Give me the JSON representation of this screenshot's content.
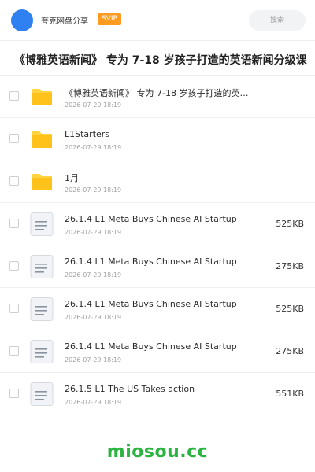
{
  "header": {
    "site_name": "夸克网盘分享",
    "badge": "SVIP",
    "search_placeholder": "搜索"
  },
  "title": "《博雅英语新闻》 专为 7-18 岁孩子打造的英语新闻分级课",
  "colors": {
    "accent": "#2f80f0",
    "badge": "#ff9b21",
    "folder": "#ffc52e",
    "brand_green": "#2bb441"
  },
  "files": [
    {
      "type": "folder",
      "icon": "folder-icon",
      "name": "《博雅英语新闻》 专为 7-18 岁孩子打造的英语新闻分级课",
      "date": "2026-07-29 18:19",
      "size": ""
    },
    {
      "type": "folder",
      "icon": "folder-icon",
      "name": "L1Starters",
      "date": "2026-07-29 18:19",
      "size": ""
    },
    {
      "type": "folder",
      "icon": "folder-icon",
      "name": "1月",
      "date": "2026-07-29 18:19",
      "size": ""
    },
    {
      "type": "file",
      "icon": "document-icon",
      "name": "26.1.4 L1 Meta Buys Chinese AI Startup",
      "date": "2026-07-29 18:19",
      "size": "525KB"
    },
    {
      "type": "file",
      "icon": "document-icon",
      "name": "26.1.4 L1 Meta Buys Chinese AI Startup",
      "date": "2026-07-29 18:19",
      "size": "275KB"
    },
    {
      "type": "file",
      "icon": "document-icon",
      "name": "26.1.4 L1 Meta Buys Chinese AI Startup",
      "date": "2026-07-29 18:19",
      "size": "525KB"
    },
    {
      "type": "file",
      "icon": "document-icon",
      "name": "26.1.4 L1 Meta Buys Chinese AI Startup",
      "date": "2026-07-29 18:19",
      "size": "275KB"
    },
    {
      "type": "file",
      "icon": "document-icon",
      "name": "26.1.5  L1 The US Takes action",
      "date": "2026-07-29 18:19",
      "size": "551KB"
    }
  ],
  "watermark": "miosou.cc"
}
